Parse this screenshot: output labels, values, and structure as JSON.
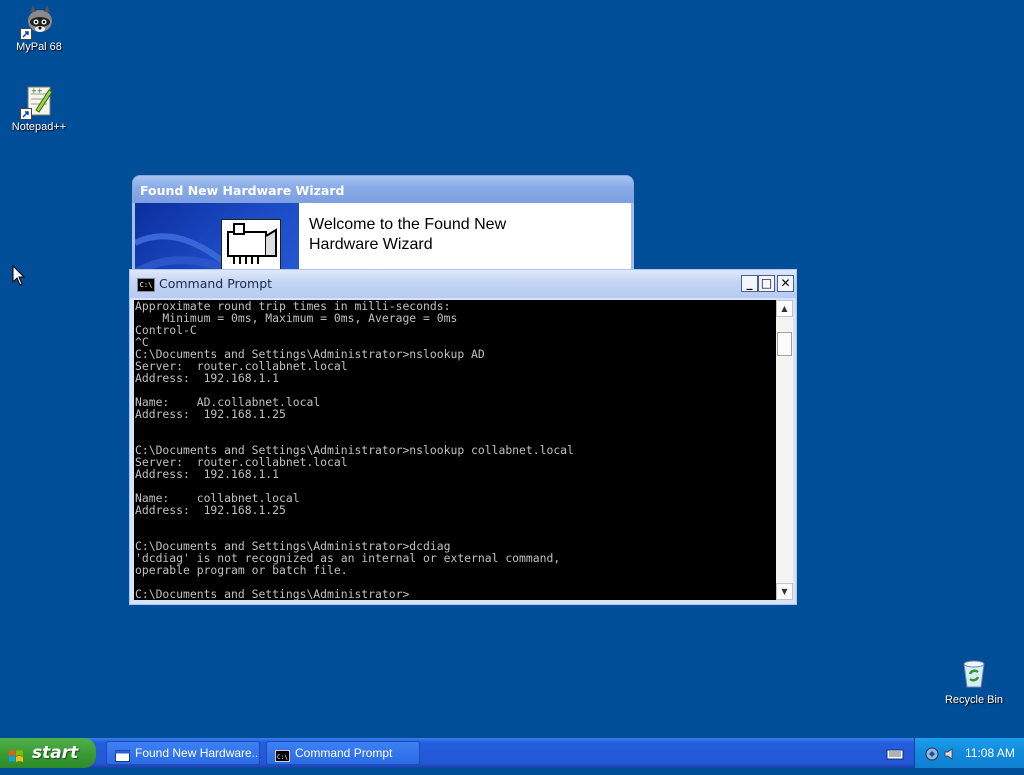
{
  "desktop": {
    "icons": [
      {
        "label": "MyPal 68"
      },
      {
        "label": "Notepad++"
      }
    ],
    "recycle_bin": {
      "label": "Recycle Bin"
    }
  },
  "wizard": {
    "title": "Found New Hardware Wizard",
    "welcome_line1": "Welcome to the Found New",
    "welcome_line2": "Hardware Wizard"
  },
  "cmd": {
    "title": "Command Prompt",
    "buttons": {
      "minimize": "_",
      "maximize": "□",
      "close": "✕"
    },
    "lines": [
      "Approximate round trip times in milli-seconds:",
      "    Minimum = 0ms, Maximum = 0ms, Average = 0ms",
      "Control-C",
      "^C",
      "C:\\Documents and Settings\\Administrator>nslookup AD",
      "Server:  router.collabnet.local",
      "Address:  192.168.1.1",
      "",
      "Name:    AD.collabnet.local",
      "Address:  192.168.1.25",
      "",
      "",
      "C:\\Documents and Settings\\Administrator>nslookup collabnet.local",
      "Server:  router.collabnet.local",
      "Address:  192.168.1.1",
      "",
      "Name:    collabnet.local",
      "Address:  192.168.1.25",
      "",
      "",
      "C:\\Documents and Settings\\Administrator>dcdiag",
      "'dcdiag' is not recognized as an internal or external command,",
      "operable program or batch file.",
      "",
      "C:\\Documents and Settings\\Administrator>"
    ]
  },
  "taskbar": {
    "start_label": "start",
    "tasks": [
      {
        "label": "Found New Hardware..."
      },
      {
        "label": "Command Prompt"
      }
    ],
    "clock": "11:08 AM"
  },
  "colors": {
    "desktop_bg": "#004e98",
    "taskbar_blue": "#245edb",
    "start_green": "#3c9c36",
    "console_text": "#c0c0c0"
  }
}
